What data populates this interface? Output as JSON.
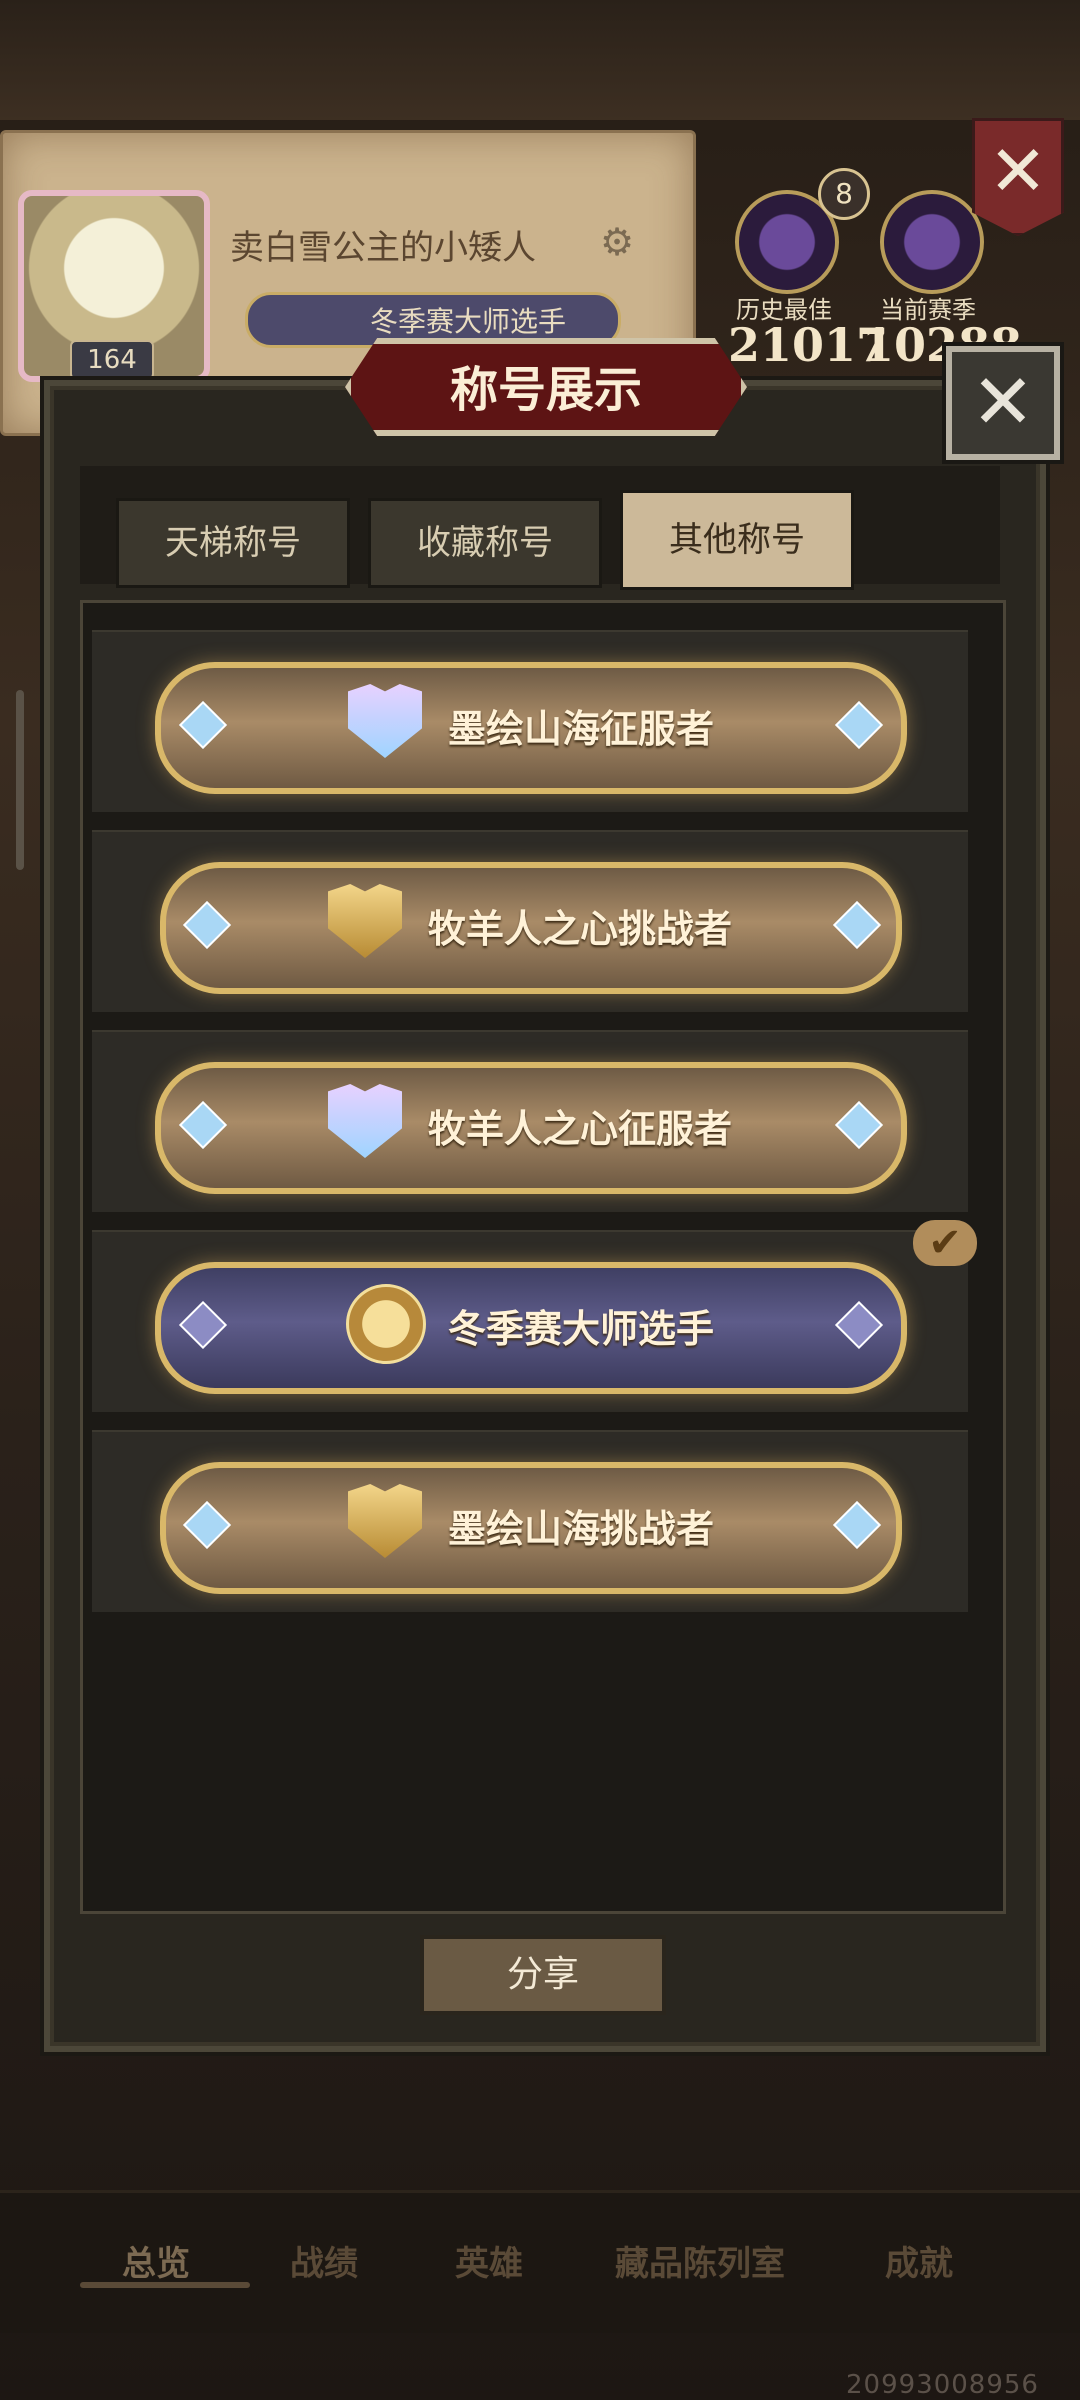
{
  "profile": {
    "username": "卖白雪公主的小矮人",
    "level": "164",
    "equipped_title": "冬季赛大师选手",
    "rank_count": "8",
    "best_label": "历史最佳",
    "best_value": "21017",
    "current_label": "当前赛季",
    "current_value": "10288",
    "icons": [
      "gear-icon",
      "close-icon"
    ]
  },
  "dialog": {
    "title": "称号展示",
    "tabs": [
      {
        "label": "天梯称号",
        "active": false
      },
      {
        "label": "收藏称号",
        "active": false
      },
      {
        "label": "其他称号",
        "active": true
      }
    ],
    "titles": [
      {
        "label": "墨绘山海征服者",
        "icon": "crystal-shield-icon",
        "style": "gold",
        "selected": false
      },
      {
        "label": "牧羊人之心挑战者",
        "icon": "gold-crown-shield-icon",
        "style": "gold",
        "selected": false
      },
      {
        "label": "牧羊人之心征服者",
        "icon": "crystal-shield-icon",
        "style": "gold",
        "selected": false
      },
      {
        "label": "冬季赛大师选手",
        "icon": "gold-medal-icon",
        "style": "blue",
        "selected": true
      },
      {
        "label": "墨绘山海挑战者",
        "icon": "gold-crown-shield-icon",
        "style": "gold",
        "selected": false
      }
    ],
    "share_label": "分享",
    "close_symbol": "✕",
    "check_symbol": "✔"
  },
  "bottom_nav": [
    {
      "label": "总览",
      "active": true
    },
    {
      "label": "战绩",
      "active": false
    },
    {
      "label": "英雄",
      "active": false
    },
    {
      "label": "藏品陈列室",
      "active": false
    },
    {
      "label": "成就",
      "active": false
    }
  ],
  "watermark": "20993008956",
  "colors": {
    "accent_gold": "#d9b869",
    "title_red": "#5d1414",
    "banner_blue": "#5e5c8a"
  }
}
